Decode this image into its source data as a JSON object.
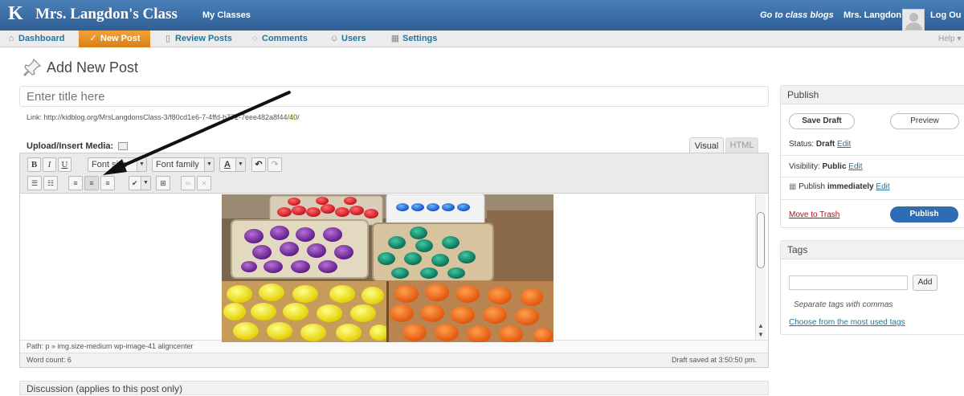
{
  "topbar": {
    "brand_letter": "K",
    "brand_title": "Mrs. Langdon's Class",
    "my_classes": "My Classes",
    "go_to_blogs": "Go to class blogs",
    "username": "Mrs. Langdon",
    "logout": "Log Ou"
  },
  "menu": {
    "items": [
      {
        "label": "Dashboard",
        "icon": "home-icon"
      },
      {
        "label": "New Post",
        "icon": "pencil-icon"
      },
      {
        "label": "Review Posts",
        "icon": "document-icon"
      },
      {
        "label": "Comments",
        "icon": "speech-bubble-icon"
      },
      {
        "label": "Users",
        "icon": "users-icon"
      },
      {
        "label": "Settings",
        "icon": "settings-icon"
      }
    ],
    "help": "Help ▾"
  },
  "page": {
    "title": "Add New Post",
    "title_placeholder": "Enter title here",
    "permalink_prefix": "Link: http://kidblog.org/MrsLangdonsClass-3/f80cd1e6-7",
    "permalink_middle": "-4ffd-b772-7eee482a8f44/",
    "permalink_hl": "40",
    "permalink_end": "/",
    "upload_label": "Upload/Insert Media:"
  },
  "editor": {
    "tab_visual": "Visual",
    "tab_html": "HTML",
    "font_size": "Font size",
    "font_family": "Font family",
    "path": "Path: p » img.size-medium wp-image-41 aligncenter",
    "word_count": "Word count: 6",
    "draft_saved": "Draft saved at 3:50:50 pm.",
    "image_alt": "Trays of colored plastic eggs"
  },
  "discussion": {
    "label": "Discussion (applies to this post only)"
  },
  "publish": {
    "heading": "Publish",
    "save_draft": "Save Draft",
    "preview": "Preview",
    "status_label": "Status: ",
    "status_value": "Draft",
    "visibility_label": "Visibility: ",
    "visibility_value": "Public",
    "schedule_prefix": "Publish ",
    "schedule_value": "immediately",
    "edit": "Edit",
    "trash": "Move to Trash",
    "publish": "Publish"
  },
  "tags": {
    "heading": "Tags",
    "add": "Add",
    "hint": "Separate tags with commas",
    "choose": "Choose from the most used tags"
  },
  "colors": {
    "topbar": "#3a6ea5",
    "new_post_tab": "#e5901a",
    "link": "#21759b",
    "publish_button": "#2e6db3",
    "trash": "#bc0b0b"
  }
}
